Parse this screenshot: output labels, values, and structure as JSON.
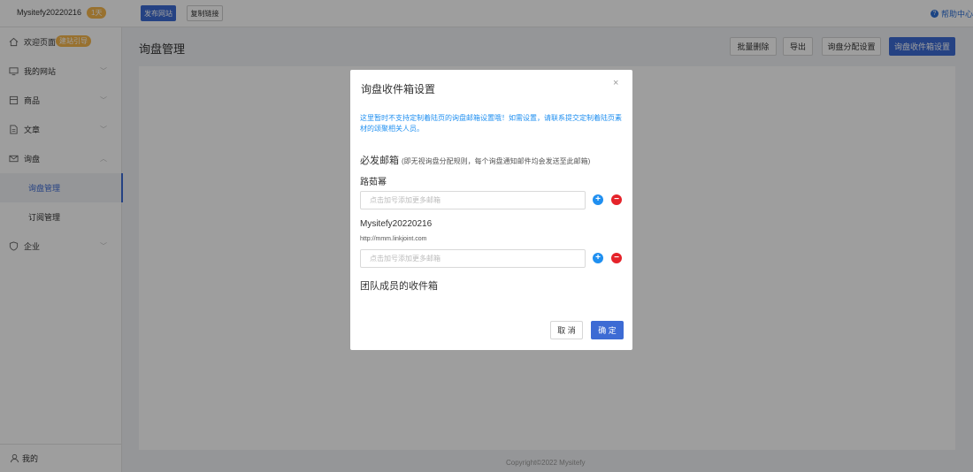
{
  "topbar": {
    "site_name": "Mysitefy20220216",
    "days_badge": "1天",
    "publish_label": "发布网站",
    "copy_link_label": "复制链接",
    "help_label": "帮助中心"
  },
  "sidebar": {
    "welcome": "欢迎页面",
    "guide_badge": "建站引导",
    "items": [
      {
        "label": "我的网站"
      },
      {
        "label": "商品"
      },
      {
        "label": "文章"
      },
      {
        "label": "询盘"
      }
    ],
    "sub_items": [
      {
        "label": "询盘管理"
      },
      {
        "label": "订阅管理"
      }
    ],
    "enterprise": "企业",
    "mine": "我的"
  },
  "page": {
    "title": "询盘管理",
    "buttons": {
      "batch_delete": "批量删除",
      "export": "导出",
      "assign_settings": "询盘分配设置",
      "inbox_settings": "询盘收件箱设置"
    },
    "footer": "Copyright©2022 Mysitefy"
  },
  "modal": {
    "title": "询盘收件箱设置",
    "close": "×",
    "notice": "这里暂时不支持定制着陆页的询盘邮箱设置哦！如需设置，请联系提交定制着陆页素材的颂聚相关人员。",
    "required_title": "必发邮箱",
    "required_hint": "(即无视询盘分配规则，每个询盘通知邮件均会发送至此邮箱)",
    "members": [
      {
        "name": "路茹幂",
        "url": "",
        "placeholder": "点击加号添加更多邮箱"
      },
      {
        "name": "Mysitefy20220216",
        "url": "http://mmm.linkjoint.com",
        "placeholder": "点击加号添加更多邮箱"
      }
    ],
    "team_title": "团队成员的收件箱",
    "cancel_label": "取 消",
    "ok_label": "确 定"
  },
  "colors": {
    "primary": "#3d6bd4",
    "notice": "#1f8ff0",
    "plus": "#1f8ff0",
    "minus": "#e5232a",
    "badge": "#f5b74c"
  }
}
